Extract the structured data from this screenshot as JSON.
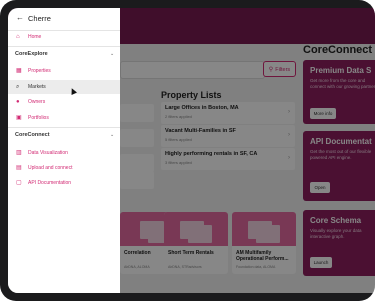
{
  "drawer": {
    "title": "Cherre",
    "home_label": "Home",
    "sections": [
      {
        "label": "CoreExplore",
        "items": [
          {
            "label": "Properties"
          },
          {
            "label": "Markets"
          },
          {
            "label": "Owners"
          },
          {
            "label": "Portfolios"
          }
        ]
      },
      {
        "label": "CoreConnect",
        "items": [
          {
            "label": "Data Visualization"
          },
          {
            "label": "Upload and connect"
          },
          {
            "label": "API Documentation"
          }
        ]
      }
    ]
  },
  "main": {
    "filters_label": "Filters",
    "property_lists": {
      "title": "Property Lists",
      "items": [
        {
          "name": "Large Offices in Boston, MA",
          "sub": "2 filters applied"
        },
        {
          "name": "Vacant Multi-Families in SF",
          "sub": "5 filters applied"
        },
        {
          "name": "Highly performing rentals in SF, CA",
          "sub": "3 filters applied"
        }
      ]
    },
    "bottom_cards": [
      {
        "title": "Correlation",
        "sub": "AirDNA, ALOMA"
      },
      {
        "title": "Short Term Rentals",
        "sub": "AirDNA, STRadvisors"
      },
      {
        "title": "AM Multifamily Operational Perform...",
        "sub": "Foundation data, ALOMA"
      }
    ]
  },
  "core_connect": {
    "title": "CoreConnect",
    "cards": [
      {
        "title": "Premium Data S",
        "desc": "Get more from the core and connect with our growing partner",
        "button": "More info"
      },
      {
        "title": "API Documentat",
        "desc": "Get the most out of our flexible powered API engine.",
        "button": "Open"
      },
      {
        "title": "Core Schema",
        "desc": "Visually explore your data interactive graph.",
        "button": "Launch"
      }
    ]
  },
  "colors": {
    "accent": "#d22b74",
    "header": "#7a1c52",
    "card": "#8e1f5f"
  }
}
